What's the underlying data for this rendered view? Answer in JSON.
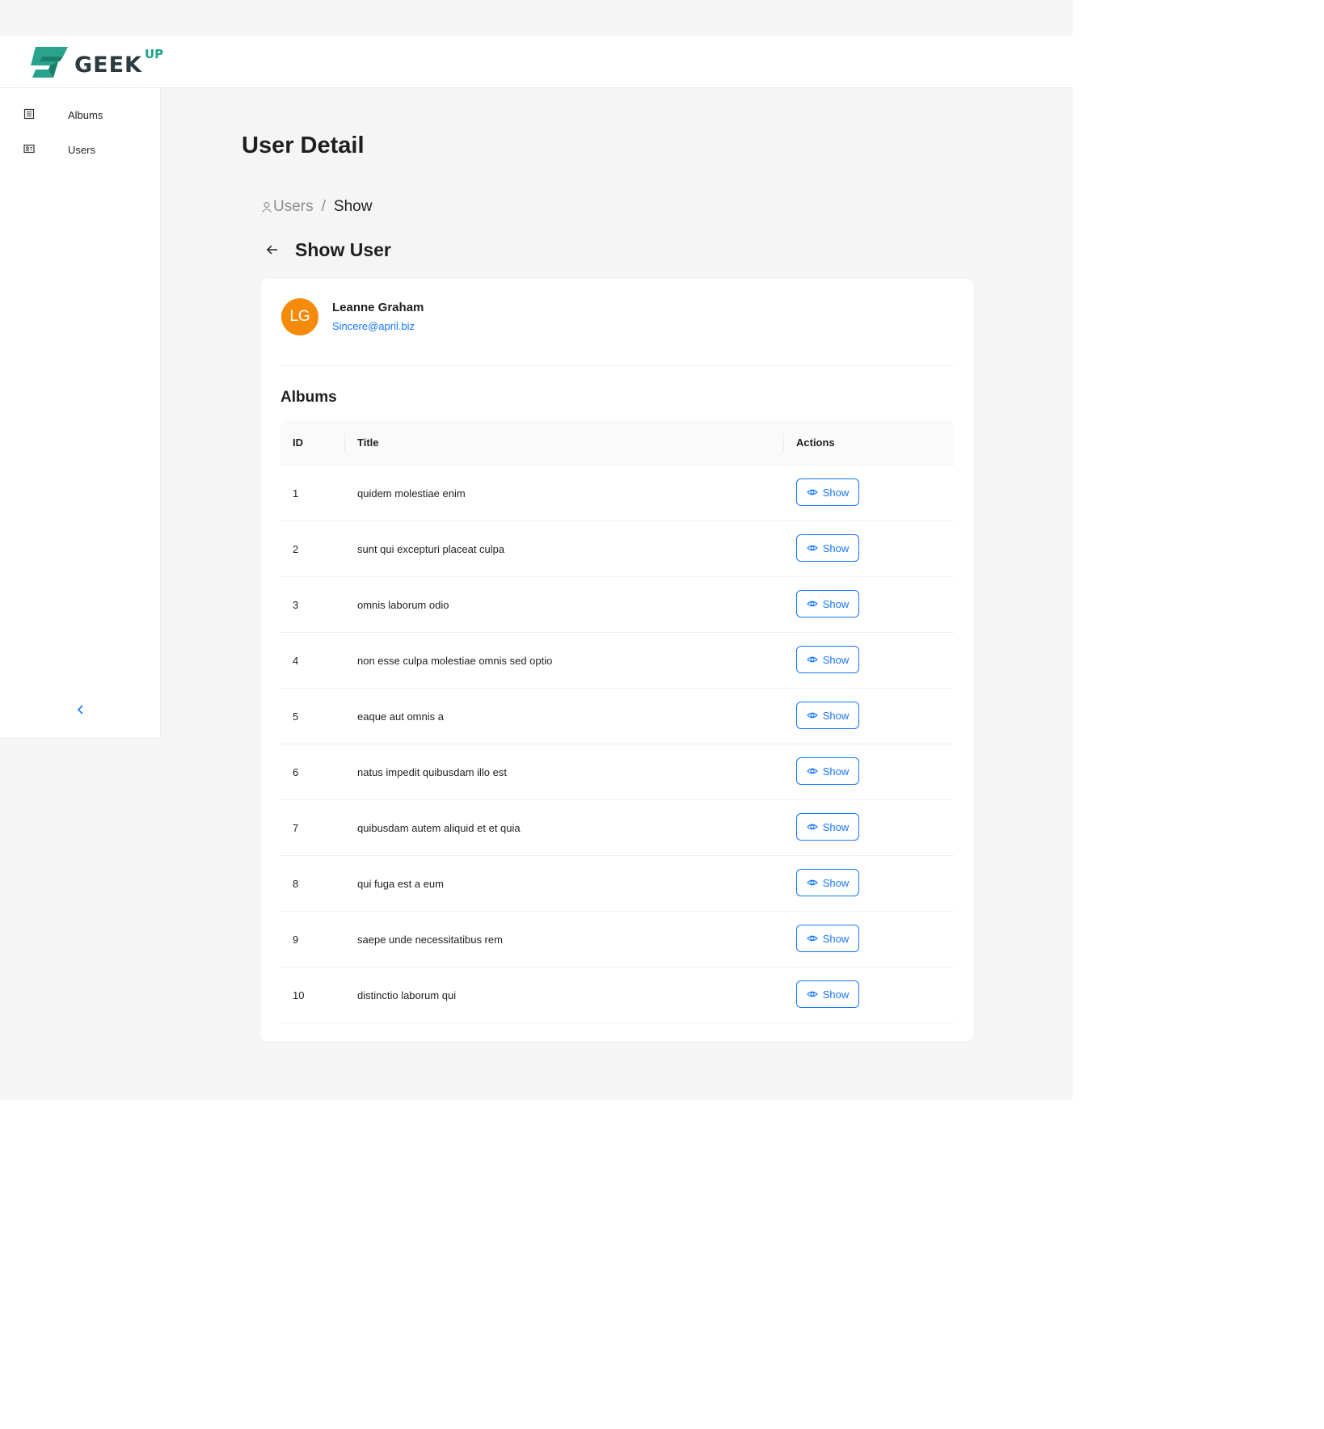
{
  "brand": {
    "name": "GEEK",
    "superscript": "UP"
  },
  "sidebar": {
    "items": [
      {
        "label": "Albums",
        "icon": "album-icon"
      },
      {
        "label": "Users",
        "icon": "user-card-icon"
      }
    ],
    "collapse_icon": "chevron-left-icon"
  },
  "page": {
    "title": "User Detail"
  },
  "breadcrumb": {
    "users_label": "Users",
    "separator": "/",
    "current": "Show"
  },
  "show": {
    "title": "Show User",
    "back_icon": "arrow-left-icon"
  },
  "user": {
    "initials": "LG",
    "name": "Leanne Graham",
    "email": "Sincere@april.biz"
  },
  "albums": {
    "heading": "Albums",
    "columns": [
      "ID",
      "Title",
      "Actions"
    ],
    "action_label": "Show",
    "rows": [
      {
        "id": "1",
        "title": "quidem molestiae enim"
      },
      {
        "id": "2",
        "title": "sunt qui excepturi placeat culpa"
      },
      {
        "id": "3",
        "title": "omnis laborum odio"
      },
      {
        "id": "4",
        "title": "non esse culpa molestiae omnis sed optio"
      },
      {
        "id": "5",
        "title": "eaque aut omnis a"
      },
      {
        "id": "6",
        "title": "natus impedit quibusdam illo est"
      },
      {
        "id": "7",
        "title": "quibusdam autem aliquid et et quia"
      },
      {
        "id": "8",
        "title": "qui fuga est a eum"
      },
      {
        "id": "9",
        "title": "saepe unde necessitatibus rem"
      },
      {
        "id": "10",
        "title": "distinctio laborum qui"
      }
    ]
  },
  "colors": {
    "accent": "#1677ff",
    "avatar": "#f58a0b",
    "brand": "#1fa38a"
  }
}
